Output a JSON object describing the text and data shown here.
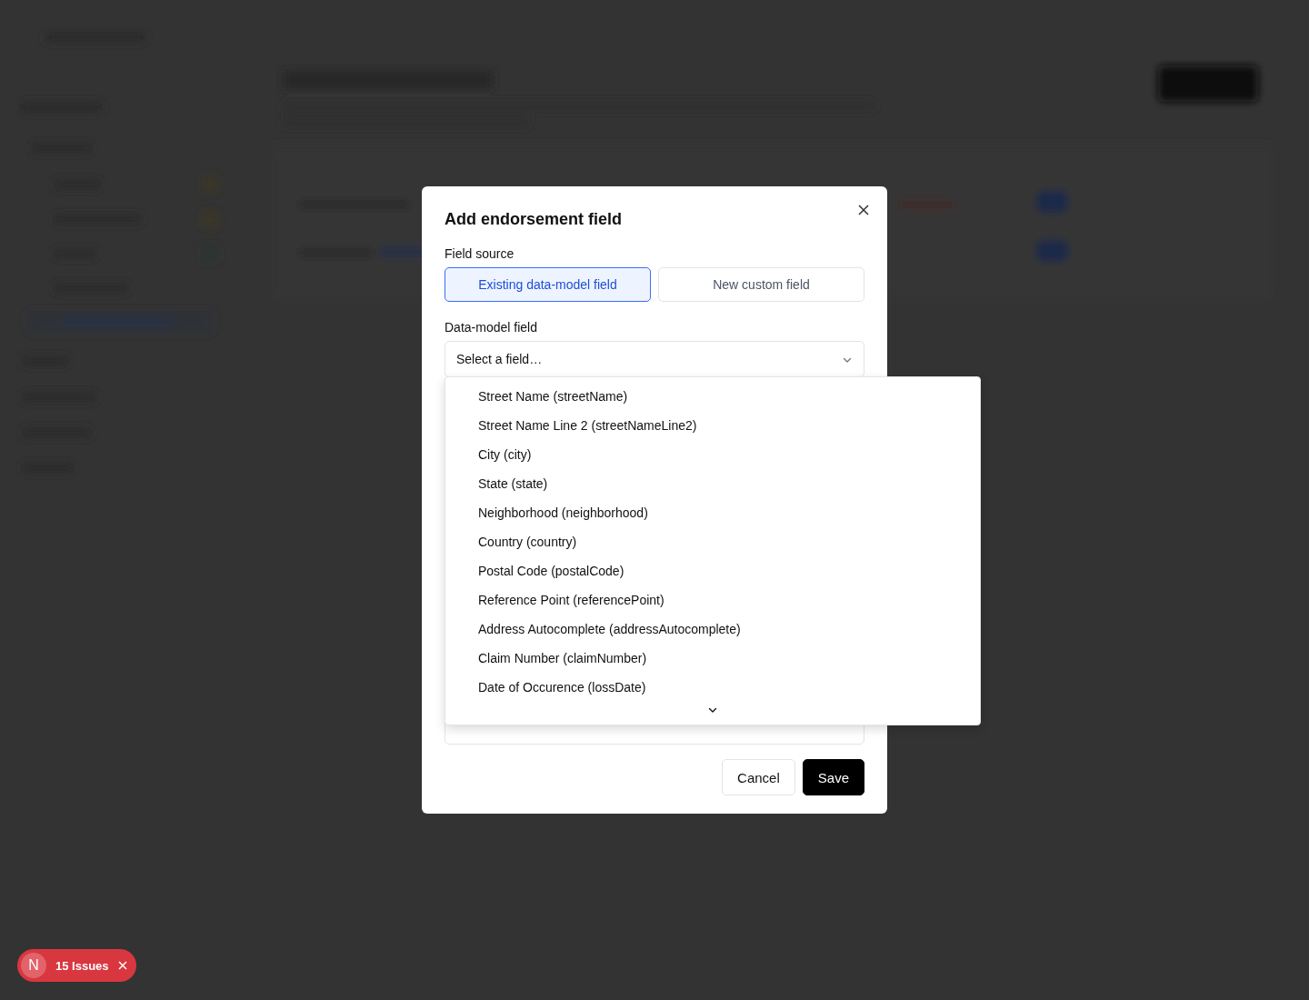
{
  "dialog": {
    "title": "Add endorsement field",
    "field_source": {
      "label": "Field source",
      "options": [
        {
          "label": "Existing data-model field",
          "selected": true
        },
        {
          "label": "New custom field",
          "selected": false
        }
      ]
    },
    "data_model_field": {
      "label": "Data-model field",
      "placeholder": "Select a field…"
    },
    "buttons": [
      {
        "label": "Cancel",
        "kind": "secondary"
      },
      {
        "label": "Save",
        "kind": "primary"
      }
    ]
  },
  "dropdown": {
    "options": [
      {
        "label": "Street Name (streetName)",
        "selected": false
      },
      {
        "label": "Street Name Line 2 (streetNameLine2)",
        "selected": false
      },
      {
        "label": "City (city)",
        "selected": false
      },
      {
        "label": "State (state)",
        "selected": false
      },
      {
        "label": "Neighborhood (neighborhood)",
        "selected": false
      },
      {
        "label": "Country (country)",
        "selected": false
      },
      {
        "label": "Postal Code (postalCode)",
        "selected": false
      },
      {
        "label": "Reference Point (referencePoint)",
        "selected": false
      },
      {
        "label": "Address Autocomplete (addressAutocomplete)",
        "selected": false
      },
      {
        "label": "Claim Number (claimNumber)",
        "selected": false
      },
      {
        "label": "Date of Occurence (lossDate)",
        "selected": false
      }
    ]
  },
  "issues_badge": {
    "logo": "N",
    "label": "15 Issues"
  }
}
